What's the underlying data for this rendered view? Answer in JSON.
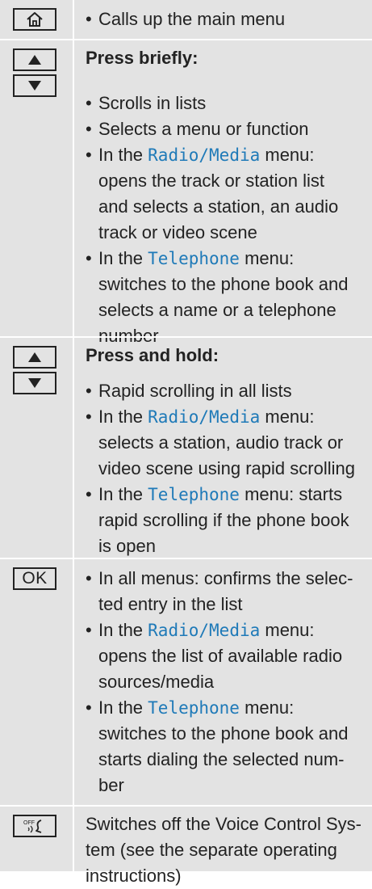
{
  "rows": {
    "home": {
      "icon": "home-icon",
      "bullet": "Calls up the main menu"
    },
    "press_briefly": {
      "icons": [
        "arrow-up-icon",
        "arrow-down-icon"
      ],
      "heading": "Press briefly:",
      "b1": "Scrolls in lists",
      "b2": "Selects a menu or function",
      "b3_prefix": "In the ",
      "b3_radio": "Radio",
      "b3_slash": "/",
      "b3_media": "Media",
      "b3_l1_rest": " menu:",
      "b3_l2": "opens the track or station list",
      "b3_l3": "and selects a station, an audio",
      "b3_l4": "track or video scene",
      "b4_prefix": "In the ",
      "b4_tel": "Telephone",
      "b4_l1_rest": " menu:",
      "b4_l2": "switches to the phone book and",
      "b4_l3": "selects a name or a telephone",
      "b4_l4": "number"
    },
    "press_hold": {
      "icons": [
        "arrow-up-icon",
        "arrow-down-icon"
      ],
      "heading": "Press and hold:",
      "b1": "Rapid scrolling in all lists",
      "b2_prefix": "In the ",
      "b2_radio": "Radio",
      "b2_slash": "/",
      "b2_media": "Media",
      "b2_l1_rest": " menu:",
      "b2_l2": "selects a station, audio track or",
      "b2_l3": "video scene using rapid scrolling",
      "b3_prefix": "In the ",
      "b3_tel": "Telephone",
      "b3_l1_rest": " menu: starts",
      "b3_l2": "rapid scrolling if the phone book",
      "b3_l3": "is open"
    },
    "ok": {
      "key_label": "OK",
      "b1_l1": "In all menus: confirms the selec-",
      "b1_l2": "ted entry in the list",
      "b2_prefix": "In the ",
      "b2_radio": "Radio",
      "b2_slash": "/",
      "b2_media": "Media",
      "b2_l1_rest": " menu:",
      "b2_l2": "opens the list of available radio",
      "b2_l3": "sources/media",
      "b3_prefix": "In the ",
      "b3_tel": "Telephone",
      "b3_l1_rest": " menu:",
      "b3_l2": "switches to the phone book and",
      "b3_l3": "starts dialing the selected num-",
      "b3_l4": "ber"
    },
    "voice_off": {
      "icon": "voice-control-off-icon",
      "icon_label": "OFF",
      "l1": "Switches off the Voice Control Sys-",
      "l2": "tem (see the separate operating",
      "l3": "instructions)"
    }
  },
  "bullet_glyph": "•",
  "colors": {
    "table_bg": "#e3e3e3",
    "highlight": "#1f7ab8",
    "text": "#222222"
  }
}
